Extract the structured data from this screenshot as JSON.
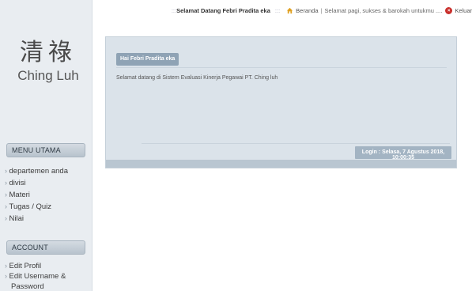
{
  "logo": {
    "chinese": "清祿",
    "name": "Ching Luh"
  },
  "topbar": {
    "welcome_prefix": "::: ",
    "welcome": "Selamat Datang Febri Pradita eka",
    "welcome_suffix": " :::",
    "home_link": "Beranda",
    "separator": "|",
    "greeting": "Selamat pagi, sukses & barokah untukmu ....",
    "logout": "Keluar"
  },
  "sidebar": {
    "menu_heading": "MENU UTAMA",
    "menu_items": [
      {
        "label": "departemen anda"
      },
      {
        "label": "divisi"
      },
      {
        "label": "Materi"
      },
      {
        "label": "Tugas / Quiz"
      },
      {
        "label": "Nilai"
      }
    ],
    "account_heading": "ACCOUNT",
    "account_items": [
      {
        "label": "Edit Profil"
      },
      {
        "label": "Edit Username &"
      },
      {
        "label": "Password"
      }
    ]
  },
  "main": {
    "user_tag": "Hai Febri Pradita eka",
    "welcome_text": "Selamat datang di Sistem Evaluasi Kinerja Pegawai PT. Ching luh",
    "login_info": "Login : Selasa, 7 Agustus 2018, 10:00:35"
  },
  "colors": {
    "sidebar_bg": "#e9edf1",
    "panel_bg": "#dbe3ea",
    "accent": "#8fa3b5",
    "logout_red": "#c9302c"
  }
}
